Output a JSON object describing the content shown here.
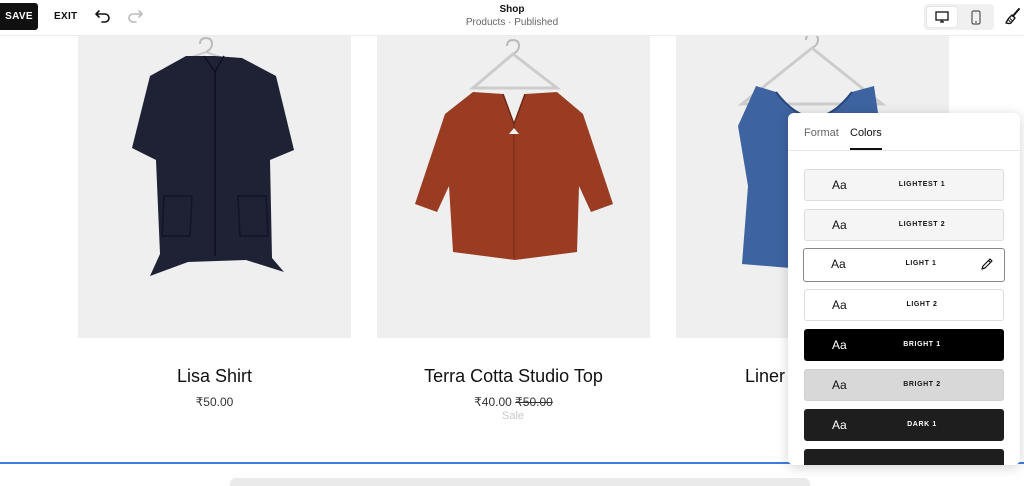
{
  "toolbar": {
    "save_label": "SAVE",
    "exit_label": "EXIT",
    "undo_icon": "undo-icon",
    "redo_icon": "redo-icon",
    "title": "Shop",
    "subtitle": "Products · Published",
    "desktop_icon": "desktop-icon",
    "mobile_icon": "mobile-icon",
    "style_icon": "paintbrush-icon"
  },
  "products": [
    {
      "name": "Lisa Shirt",
      "price": "₹50.00",
      "garment_color": "#1f2235"
    },
    {
      "name": "Terra Cotta Studio Top",
      "price": "₹40.00",
      "original_price": "₹50.00",
      "sale_label": "Sale",
      "garment_color": "#9a3c22"
    },
    {
      "name": "Liner",
      "garment_color": "#3d63a0"
    }
  ],
  "panel": {
    "tabs": [
      "Format",
      "Colors"
    ],
    "active_tab": "Colors",
    "swatches": [
      {
        "aa": "Aa",
        "label": "LIGHTEST 1",
        "bg": "#f5f5f5",
        "fg": "#111111"
      },
      {
        "aa": "Aa",
        "label": "LIGHTEST 2",
        "bg": "#f5f5f5",
        "fg": "#111111"
      },
      {
        "aa": "Aa",
        "label": "LIGHT 1",
        "bg": "#ffffff",
        "fg": "#111111",
        "active": true
      },
      {
        "aa": "Aa",
        "label": "LIGHT 2",
        "bg": "#ffffff",
        "fg": "#111111"
      },
      {
        "aa": "Aa",
        "label": "BRIGHT 1",
        "bg": "#000000",
        "fg": "#ffffff"
      },
      {
        "aa": "Aa",
        "label": "BRIGHT 2",
        "bg": "#d8d8d8",
        "fg": "#111111"
      },
      {
        "aa": "Aa",
        "label": "DARK 1",
        "bg": "#1e1e1e",
        "fg": "#ffffff"
      }
    ]
  },
  "colors": {
    "accent": "#3e7de0",
    "product_bg": "#efefef"
  }
}
